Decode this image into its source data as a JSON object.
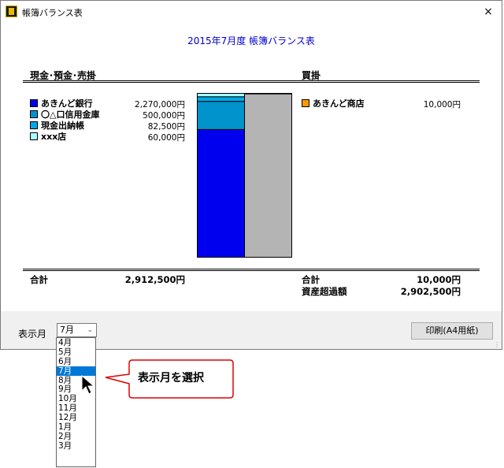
{
  "window": {
    "title": "帳簿バランス表",
    "close_glyph": "×"
  },
  "report": {
    "title": "2015年7月度 帳簿バランス表"
  },
  "assets": {
    "heading": "現金･預金･売掛",
    "items": [
      {
        "label": "あきんど銀行",
        "amount": "2,270,000円",
        "value": 2270000,
        "color": "#0000ee"
      },
      {
        "label": "〇△口信用金庫",
        "amount": "500,000円",
        "value": 500000,
        "color": "#0093cc"
      },
      {
        "label": "現金出納帳",
        "amount": "82,500円",
        "value": 82500,
        "color": "#00aae8"
      },
      {
        "label": "xxx店",
        "amount": "60,000円",
        "value": 60000,
        "color": "#a8ffff"
      }
    ],
    "total_label": "合計",
    "total_amount": "2,912,500円"
  },
  "liabilities": {
    "heading": "買掛",
    "items": [
      {
        "label": "あきんど商店",
        "amount": "10,000円",
        "value": 10000,
        "color": "#ff9900"
      }
    ],
    "total_label": "合計",
    "total_amount": "10,000円",
    "excess_label": "資産超過額",
    "excess_amount": "2,902,500円",
    "excess_value": 2902500,
    "excess_color": "#b4b4b4"
  },
  "controls": {
    "month_label": "表示月",
    "selected_month": "7月",
    "months": [
      "4月",
      "5月",
      "6月",
      "7月",
      "8月",
      "9月",
      "10月",
      "11月",
      "12月",
      "1月",
      "2月",
      "3月"
    ],
    "print_label": "印刷(A4用紙)"
  },
  "callout": {
    "text": "表示月を選択",
    "border_color": "#e00000"
  }
}
